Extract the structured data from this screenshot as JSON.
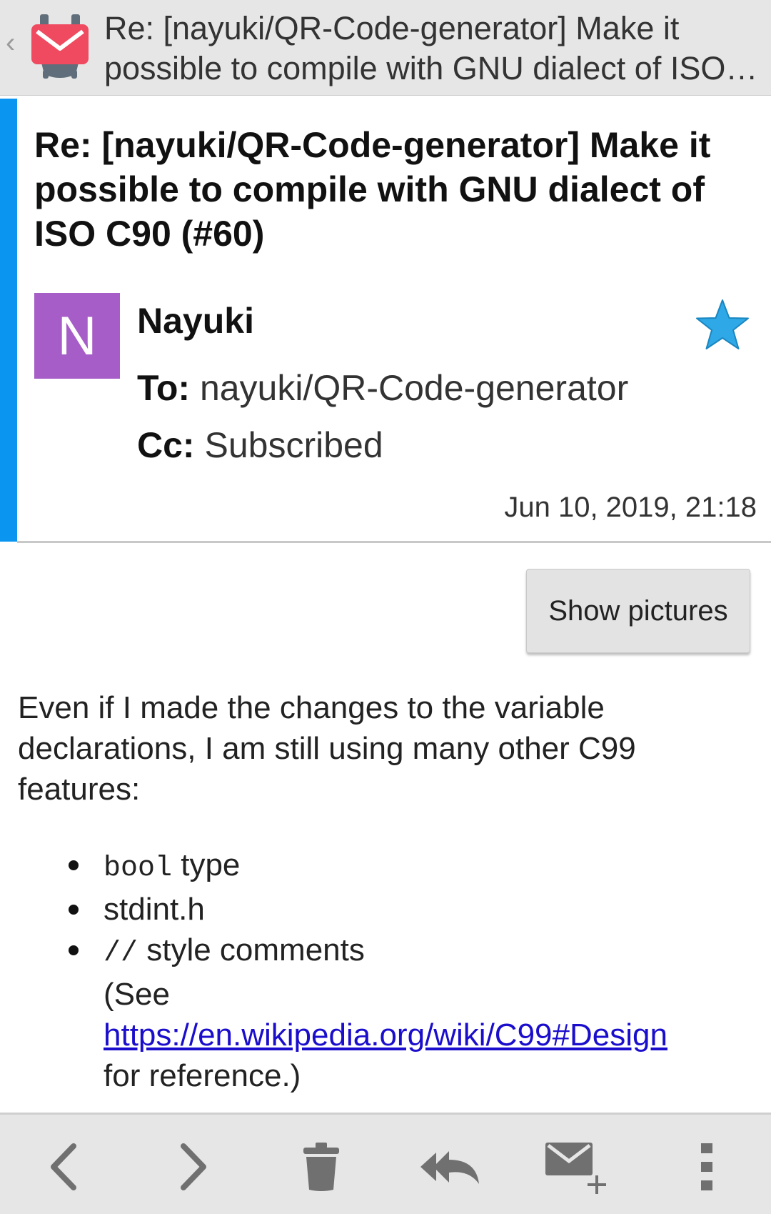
{
  "appbar": {
    "title": "Re: [nayuki/QR-Code-generator] Make it possible to compile with GNU dialect of ISO C90 (#60)",
    "up_glyph": "‹"
  },
  "message": {
    "subject": "Re: [nayuki/QR-Code-generator] Make it possible to compile with GNU dialect of ISO C90 (#60)",
    "avatar_letter": "N",
    "avatar_color": "#a65dc7",
    "sender": "Nayuki",
    "starred": true,
    "to_label": "To:",
    "to_value": "nayuki/QR-Code-generator",
    "cc_label": "Cc:",
    "cc_value": "Subscribed",
    "date": "Jun 10, 2019, 21:18"
  },
  "show_pictures_label": "Show pictures",
  "body": {
    "paragraph": "Even if I made the changes to the variable declarations, I am still using many other C99 features:",
    "bullet1_code": "bool",
    "bullet1_text": " type",
    "bullet2_text": "stdint.h",
    "bullet3_code": "//",
    "bullet3_text": " style comments",
    "see_text": "(See",
    "link_text": "https://en.wikipedia.org/wiki/C99#Design",
    "after_link": "for reference.)"
  },
  "toolbar": {
    "items": [
      "previous-icon",
      "next-icon",
      "delete-icon",
      "reply-all-icon",
      "compose-icon",
      "overflow-menu-icon"
    ]
  },
  "colors": {
    "accent": "#0a96f0",
    "star": "#2ea8e6",
    "link": "#1a0dcc"
  }
}
